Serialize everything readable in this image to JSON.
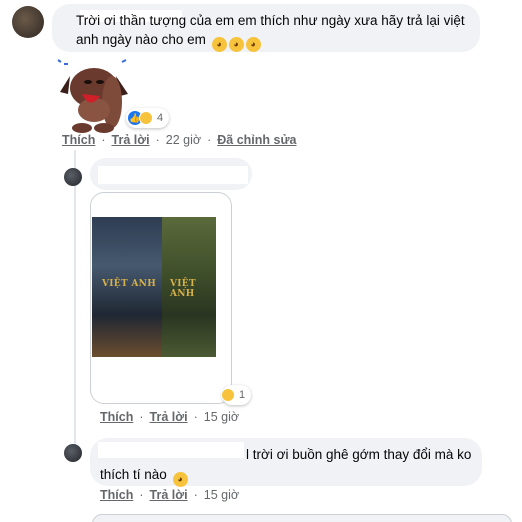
{
  "comment_main": {
    "text": "Trời ơi thần tượng của em em thích như ngày xưa hãy trả lại việt anh ngày nào cho em",
    "reaction_count": "4",
    "actions": {
      "like": "Thích",
      "reply": "Trả lời",
      "time": "22 giờ",
      "edited": "Đã chỉnh sửa"
    }
  },
  "reply_photo": {
    "watermark_left": "VIỆT ANH",
    "watermark_right": "VIỆT ANH",
    "reaction_count": "1",
    "actions": {
      "like": "Thích",
      "reply": "Trả lời",
      "time": "15 giờ"
    }
  },
  "reply_text": {
    "text": "l trời ơi buồn ghê gớm thay đổi mà ko thích tí nào",
    "actions": {
      "like": "Thích",
      "reply": "Trả lời",
      "time": "15 giờ"
    }
  },
  "colors": {
    "bubble": "#f0f2f5",
    "link": "#65676b",
    "like_blue": "#1877f2",
    "emoji_yellow": "#f7c33d"
  },
  "icons": [
    "crying-emoji-icon",
    "like-reaction-icon",
    "sad-reaction-icon",
    "sticker-crying-dog"
  ]
}
